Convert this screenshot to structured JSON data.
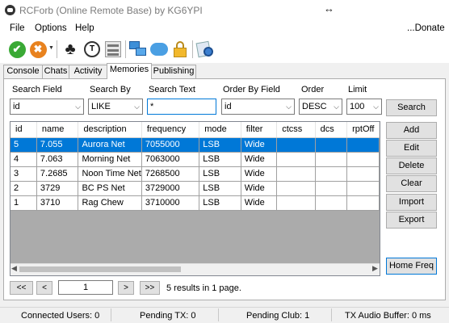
{
  "window": {
    "title": "RCForb (Online Remote Base) by KG6YPI",
    "donate": "...Donate"
  },
  "menu": {
    "items": [
      "File",
      "Options",
      "Help"
    ]
  },
  "toolbar": {
    "icons": [
      "connect-icon",
      "disconnect-icon",
      "club-icon",
      "tx-icon",
      "profile-icon",
      "network-icon",
      "cloud-icon",
      "lock-icon",
      "settings-icon"
    ]
  },
  "tabs": [
    "Console",
    "Chats",
    "Activity",
    "Memories",
    "Publishing"
  ],
  "active_tab": "Memories",
  "search": {
    "field_label": "Search Field",
    "field_value": "id",
    "by_label": "Search By",
    "by_value": "LIKE",
    "text_label": "Search Text",
    "text_value": "*",
    "order_field_label": "Order By Field",
    "order_field_value": "id",
    "order_label": "Order",
    "order_value": "DESC",
    "limit_label": "Limit",
    "limit_value": "100",
    "search_button": "Search"
  },
  "grid": {
    "columns": [
      "id",
      "name",
      "description",
      "frequency",
      "mode",
      "filter",
      "ctcss",
      "dcs",
      "rptOff"
    ],
    "rows": [
      [
        "5",
        "7.055",
        "Aurora Net",
        "7055000",
        "LSB",
        "Wide",
        "",
        "",
        ""
      ],
      [
        "4",
        "7.063",
        "Morning Net",
        "7063000",
        "LSB",
        "Wide",
        "",
        "",
        ""
      ],
      [
        "3",
        "7.2685",
        "Noon Time Net",
        "7268500",
        "LSB",
        "Wide",
        "",
        "",
        ""
      ],
      [
        "2",
        "3729",
        "BC PS Net",
        "3729000",
        "LSB",
        "Wide",
        "",
        "",
        ""
      ],
      [
        "1",
        "3710",
        "Rag Chew",
        "3710000",
        "LSB",
        "Wide",
        "",
        "",
        ""
      ]
    ],
    "selected_row": 0
  },
  "actions": {
    "add": "Add",
    "edit": "Edit",
    "delete": "Delete",
    "clear": "Clear",
    "import": "Import",
    "export": "Export",
    "home_freq": "Home Freq"
  },
  "paging": {
    "first": "<<",
    "prev": "<",
    "page": "1",
    "next": ">",
    "last": ">>",
    "results": "5 results in 1 page."
  },
  "status": {
    "connected_users": "Connected Users: 0",
    "pending_tx": "Pending TX: 0",
    "pending_club": "Pending Club: 1",
    "tx_audio_buffer": "TX Audio Buffer: 0 ms"
  }
}
